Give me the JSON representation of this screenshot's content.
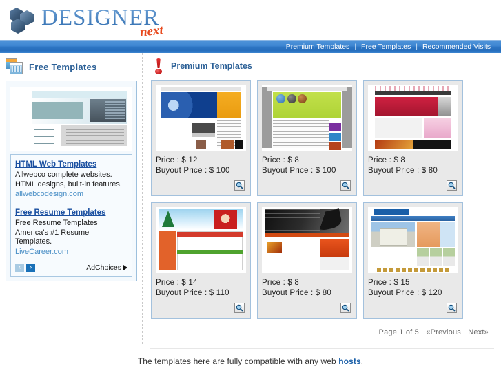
{
  "site": {
    "logo_primary": "DESIGNER",
    "logo_secondary": "next"
  },
  "nav": {
    "items": [
      {
        "label": "Premium Templates"
      },
      {
        "label": "Free Templates"
      },
      {
        "label": "Recommended Visits"
      }
    ],
    "separator": "|"
  },
  "sidebar": {
    "title": "Free Templates",
    "ads": [
      {
        "title": "HTML Web Templates",
        "description": "Allwebco complete websites. HTML designs, built-in features.",
        "url": "allwebcodesign.com"
      },
      {
        "title": "Free Resume Templates",
        "description": "Free Resume Templates America's #1 Resume Templates.",
        "url": "LiveCareer.com"
      }
    ],
    "ad_prev": "‹",
    "ad_next": "›",
    "adchoices": "AdChoices"
  },
  "main": {
    "title": "Premium Templates",
    "price_label": "Price :",
    "buyout_label": "Buyout Price :",
    "currency": "$",
    "cards": [
      {
        "theme": "th1",
        "price": "Price : $ 12",
        "buyout": "Buyout Price : $ 100"
      },
      {
        "theme": "th2",
        "price": "Price : $ 8",
        "buyout": "Buyout Price : $ 100"
      },
      {
        "theme": "th3",
        "price": "Price : $ 8",
        "buyout": "Buyout Price : $ 80"
      },
      {
        "theme": "th4",
        "price": "Price : $ 14",
        "buyout": "Buyout Price : $ 110"
      },
      {
        "theme": "th5",
        "price": "Price : $ 8",
        "buyout": "Buyout Price : $ 80"
      },
      {
        "theme": "th6",
        "price": "Price : $ 15",
        "buyout": "Buyout Price : $ 120"
      }
    ]
  },
  "pagination": {
    "page_info": "Page 1 of 5",
    "previous": "«Previous",
    "next": "Next»"
  },
  "footer": {
    "text_before": "The templates here are fully compatible with any web ",
    "link": "hosts",
    "text_after": "."
  },
  "colors": {
    "nav_blue": "#2f76c4",
    "heading_blue": "#2a5f96",
    "logo_orange": "#e8491d",
    "link_blue": "#1a5fa8",
    "card_bg": "#e9e9e9",
    "card_border": "#a3c1dd"
  }
}
